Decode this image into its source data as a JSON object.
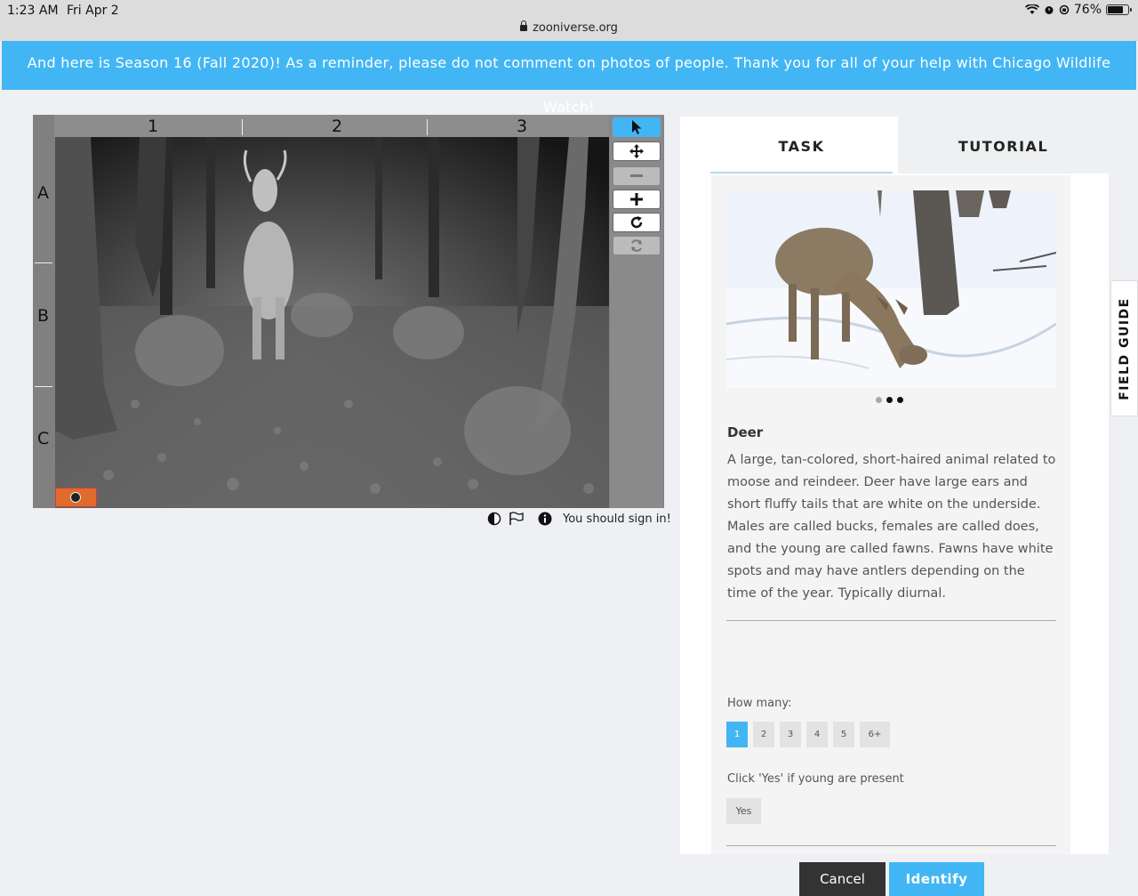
{
  "status_bar": {
    "time": "1:23 AM",
    "date": "Fri Apr 2",
    "url": "zooniverse.org",
    "battery": "76%",
    "battery_level": 0.76
  },
  "banner": {
    "text": "And here is Season 16 (Fall 2020)! As a reminder, please do not comment on photos of people. Thank you for all of your help with Chicago Wildlife Watch!"
  },
  "viewer": {
    "columns": [
      "1",
      "2",
      "3"
    ],
    "rows": [
      "A",
      "B",
      "C"
    ],
    "tools": [
      "pointer-icon",
      "move-icon",
      "zoom-out-icon",
      "zoom-in-icon",
      "rotate-icon",
      "reset-icon"
    ],
    "footer_text": "You should sign in!"
  },
  "panel": {
    "tabs": {
      "task": "TASK",
      "tutorial": "TUTORIAL"
    },
    "animal_name": "Deer",
    "description": "A large, tan-colored, short-haired animal related to moose and reindeer. Deer have large ears and short fluffy tails that are white on the underside. Males are called bucks, females are called does, and the young are called fawns. Fawns have white spots and may have antlers depending on the time of the year. Typically diurnal.",
    "how_many_label": "How many:",
    "counts": [
      "1",
      "2",
      "3",
      "4",
      "5",
      "6+"
    ],
    "selected_count": "1",
    "young_label": "Click 'Yes' if young are present",
    "yes_label": "Yes",
    "cancel_label": "Cancel",
    "identify_label": "Identify"
  },
  "field_guide": {
    "label": "FIELD GUIDE"
  },
  "colors": {
    "accent": "#42b6f4",
    "dark_button": "#333333"
  }
}
